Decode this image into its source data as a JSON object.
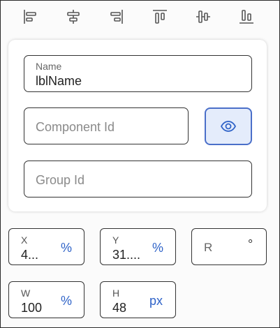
{
  "align_toolbar": {
    "buttons": [
      {
        "name": "align-left-icon"
      },
      {
        "name": "align-center-horizontal-icon"
      },
      {
        "name": "align-right-icon"
      },
      {
        "name": "align-top-icon"
      },
      {
        "name": "align-center-vertical-icon"
      },
      {
        "name": "align-bottom-icon"
      }
    ]
  },
  "properties": {
    "name": {
      "label": "Name",
      "value": "lblName"
    },
    "component_id": {
      "placeholder": "Component Id"
    },
    "group_id": {
      "placeholder": "Group Id"
    },
    "visibility_icon": "eye-icon"
  },
  "transform": {
    "x": {
      "label": "X",
      "value": "4...",
      "unit": "%"
    },
    "y": {
      "label": "Y",
      "value": "31....",
      "unit": "%"
    },
    "r": {
      "placeholder": "R",
      "unit": "°"
    },
    "w": {
      "label": "W",
      "value": "100",
      "unit": "%"
    },
    "h": {
      "label": "H",
      "value": "48",
      "unit": "px"
    }
  },
  "colors": {
    "accent": "#2f63c8",
    "eye_bg": "#e4ecfb",
    "eye_border": "#4a6fc9"
  }
}
